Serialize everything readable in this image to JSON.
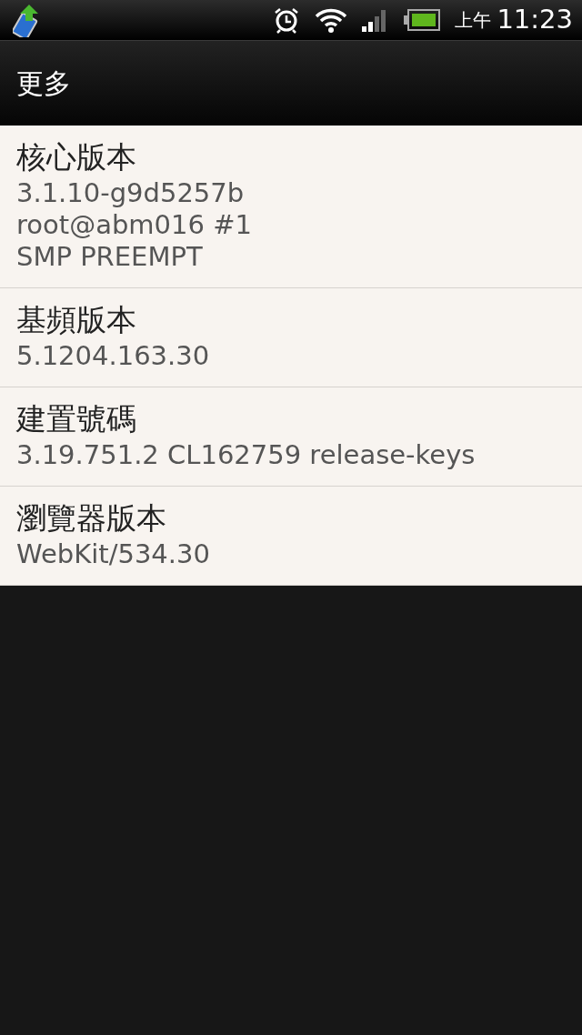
{
  "status_bar": {
    "am_pm": "上午",
    "time": "11:23"
  },
  "title_bar": {
    "title": "更多"
  },
  "items": [
    {
      "title": "核心版本",
      "summary": [
        "3.1.10-g9d5257b",
        "root@abm016 #1",
        "SMP PREEMPT"
      ]
    },
    {
      "title": "基頻版本",
      "summary": [
        "5.1204.163.30"
      ]
    },
    {
      "title": "建置號碼",
      "summary": [
        "3.19.751.2 CL162759 release-keys"
      ]
    },
    {
      "title": "瀏覽器版本",
      "summary": [
        "WebKit/534.30"
      ]
    }
  ]
}
